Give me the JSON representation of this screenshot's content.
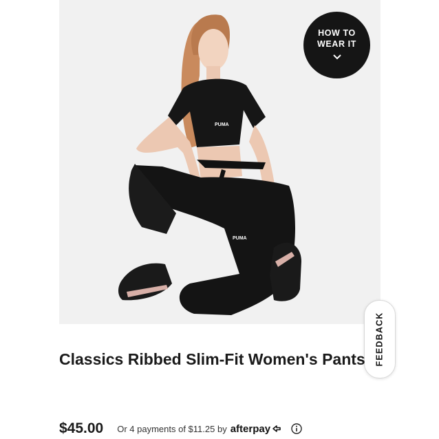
{
  "product_image": {
    "alt": "Model wearing black Classics ribbed crop top and slim-fit pants with black sneakers"
  },
  "how_to_wear": {
    "line1": "HOW TO",
    "line2": "WEAR IT",
    "icon": "chevron-down-icon"
  },
  "feedback": {
    "label": "FEEDBACK"
  },
  "product": {
    "title": "Classics Ribbed Slim-Fit Women's Pants",
    "price": "$45.00",
    "installments": "Or 4 payments of $11.25 by",
    "provider": "afterpay",
    "info_icon": "info-icon"
  },
  "colors": {
    "accent": "#151515",
    "background": "#ffffff",
    "image_bg": "#f1f1f1"
  }
}
